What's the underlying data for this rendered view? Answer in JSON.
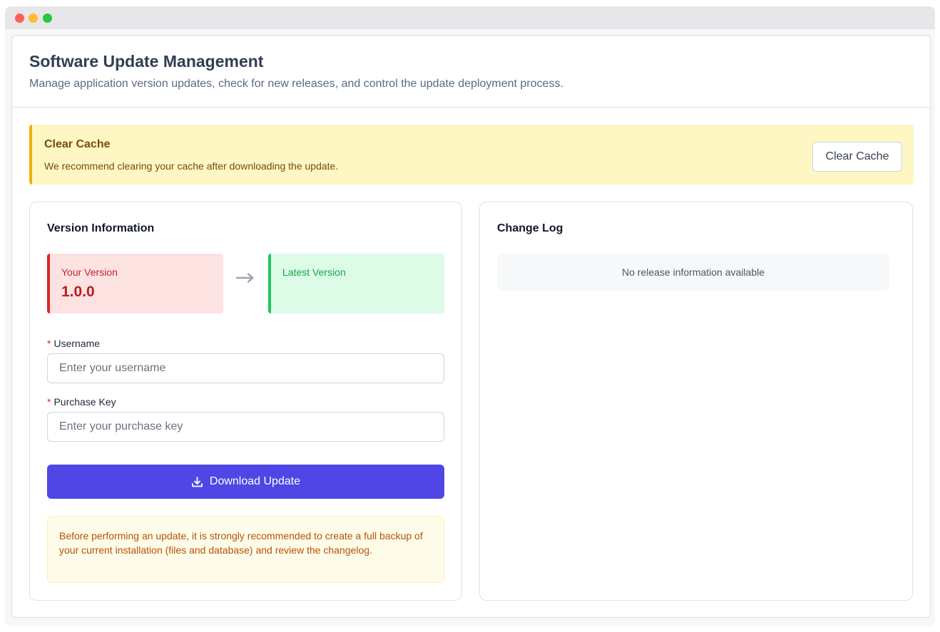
{
  "header": {
    "title": "Software Update Management",
    "subtitle": "Manage application version updates, check for new releases, and control the update deployment process."
  },
  "cache_alert": {
    "title": "Clear Cache",
    "message": "We recommend clearing your cache after downloading the update.",
    "button_label": "Clear Cache"
  },
  "version_info": {
    "title": "Version Information",
    "current_label": "Your Version",
    "current_value": "1.0.0",
    "latest_label": "Latest Version",
    "latest_value": ""
  },
  "form": {
    "username": {
      "required_mark": "*",
      "label": "Username",
      "placeholder": "Enter your username",
      "value": ""
    },
    "purchase_key": {
      "required_mark": "*",
      "label": "Purchase Key",
      "placeholder": "Enter your purchase key",
      "value": ""
    },
    "download_button_label": "Download Update",
    "backup_notice": "Before performing an update, it is strongly recommended to create a full backup of your current installation (files and database) and review the changelog."
  },
  "changelog": {
    "title": "Change Log",
    "empty_message": "No release information available"
  },
  "icons": {
    "arrow": "arrow-right-icon",
    "download": "download-icon"
  },
  "colors": {
    "primary": "#4f46e5",
    "warning_bg": "#fef7c3",
    "warning_border": "#eab308",
    "current_version_accent": "#dc2626",
    "latest_version_accent": "#22c55e"
  }
}
